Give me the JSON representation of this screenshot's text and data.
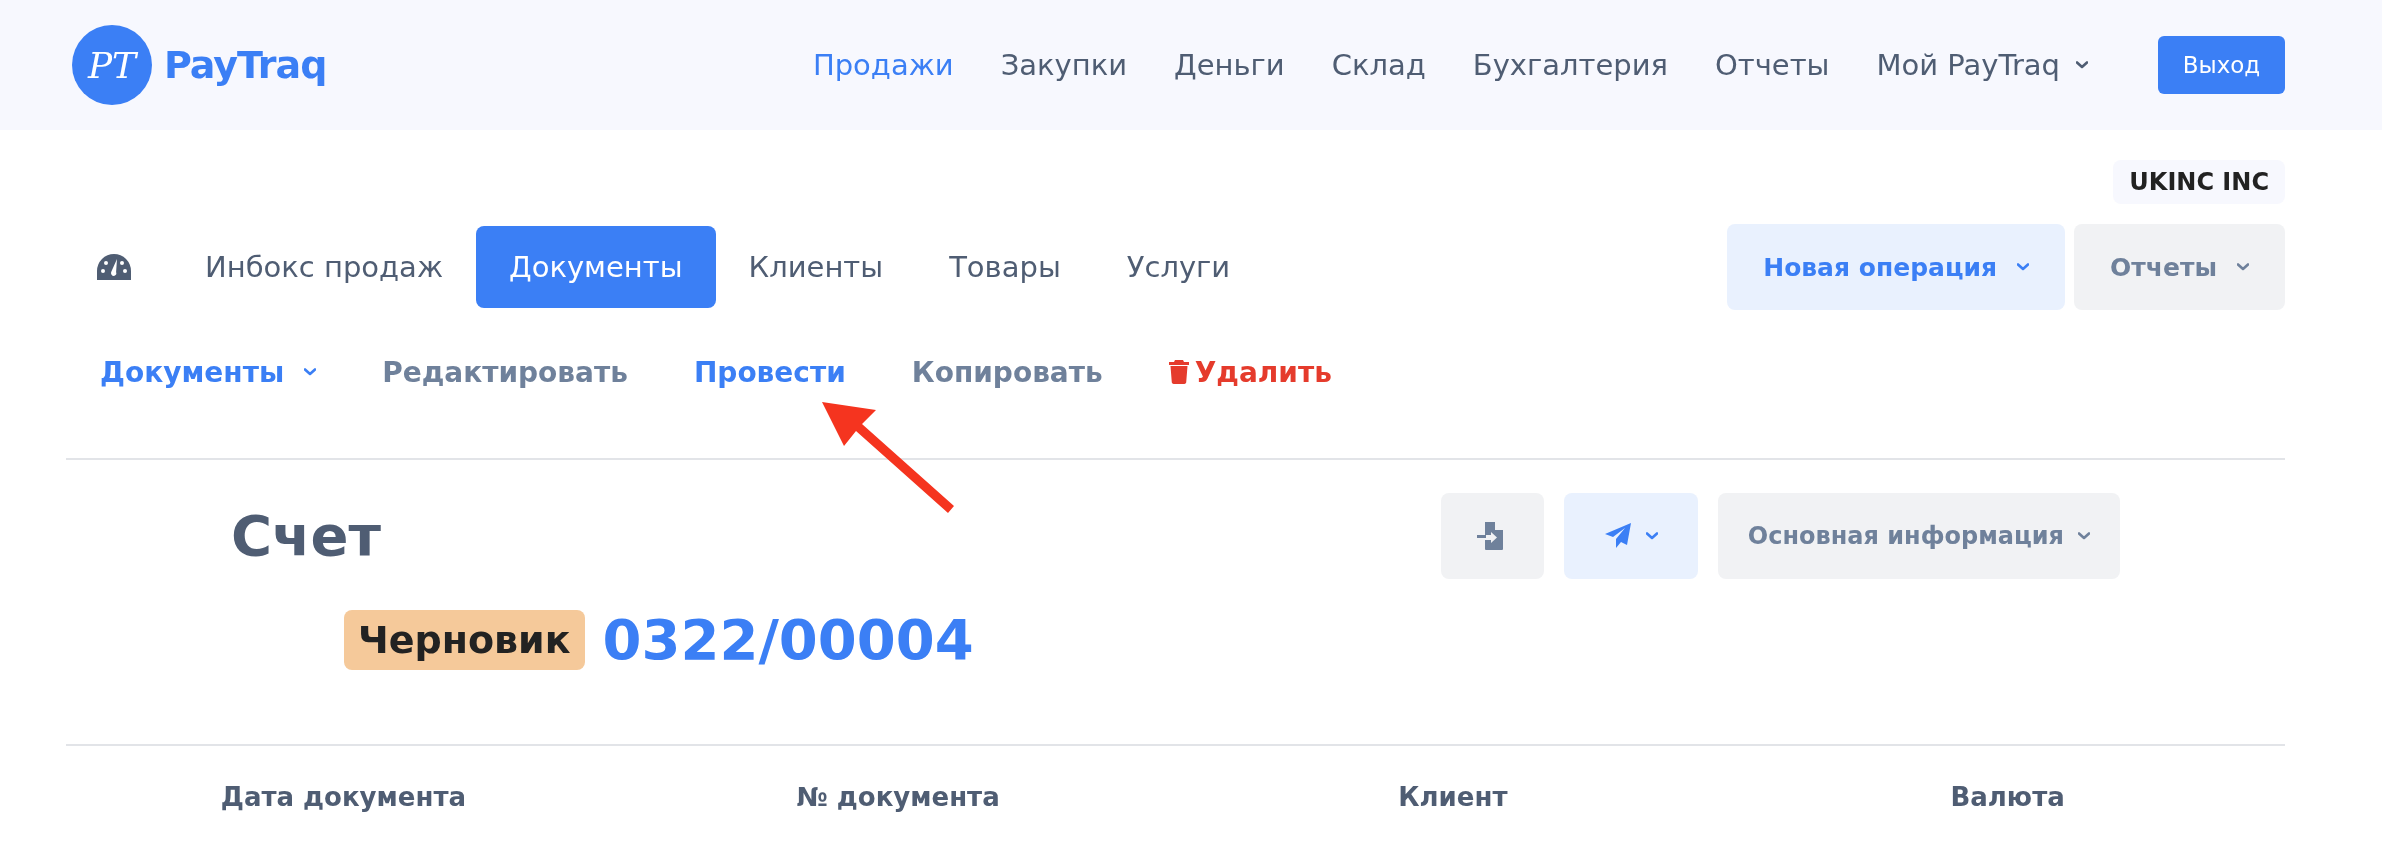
{
  "header": {
    "logo": {
      "mark": "PT",
      "name": "PayTraq"
    },
    "nav": [
      {
        "label": "Продажи",
        "selected": true,
        "dropdown": false
      },
      {
        "label": "Закупки",
        "selected": false,
        "dropdown": false
      },
      {
        "label": "Деньги",
        "selected": false,
        "dropdown": false
      },
      {
        "label": "Склад",
        "selected": false,
        "dropdown": false
      },
      {
        "label": "Бухгалтерия",
        "selected": false,
        "dropdown": false
      },
      {
        "label": "Отчеты",
        "selected": false,
        "dropdown": false
      },
      {
        "label": "Мой PayTraq",
        "selected": false,
        "dropdown": true
      }
    ],
    "logout": "Выход"
  },
  "company": "UKINC INC",
  "tabs": [
    {
      "label": "Инбокс продаж",
      "selected": false
    },
    {
      "label": "Документы",
      "selected": true
    },
    {
      "label": "Клиенты",
      "selected": false
    },
    {
      "label": "Товары",
      "selected": false
    },
    {
      "label": "Услуги",
      "selected": false
    }
  ],
  "tool_buttons": [
    {
      "label": "Новая операция",
      "kind": "primary"
    },
    {
      "label": "Отчеты",
      "kind": "secondary"
    }
  ],
  "actions": [
    {
      "label": "Документы",
      "kind": "menu"
    },
    {
      "label": "Редактировать",
      "kind": "link"
    },
    {
      "label": "Провести",
      "kind": "primary"
    },
    {
      "label": "Копировать",
      "kind": "link"
    },
    {
      "label": "Удалить",
      "kind": "danger"
    }
  ],
  "document": {
    "type": "Счет",
    "status": "Черновик",
    "number": "0322/00004",
    "buttons": [
      {
        "kind": "import"
      },
      {
        "kind": "send"
      },
      {
        "kind": "section",
        "label": "Основная информация"
      }
    ]
  },
  "columns": [
    "Дата документа",
    "№ документа",
    "Клиент",
    "Валюта"
  ]
}
